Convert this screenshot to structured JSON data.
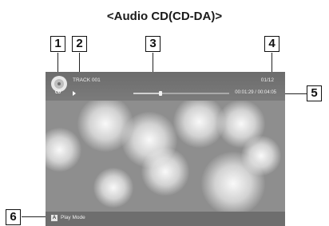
{
  "page": {
    "title": "<Audio CD(CD-DA)>"
  },
  "callouts": [
    "1",
    "2",
    "3",
    "4",
    "5",
    "6"
  ],
  "screen": {
    "disc_icon": "cd-disc-icon",
    "disc_label": "CD",
    "track_title": "TRACK 001",
    "track_count": "01/12",
    "playback_state_icon": "play-icon",
    "progress_fraction": 0.28,
    "time": "00:01:29 / 00:04:05",
    "bottom": {
      "button_key": "A",
      "label": "Play Mode"
    }
  }
}
